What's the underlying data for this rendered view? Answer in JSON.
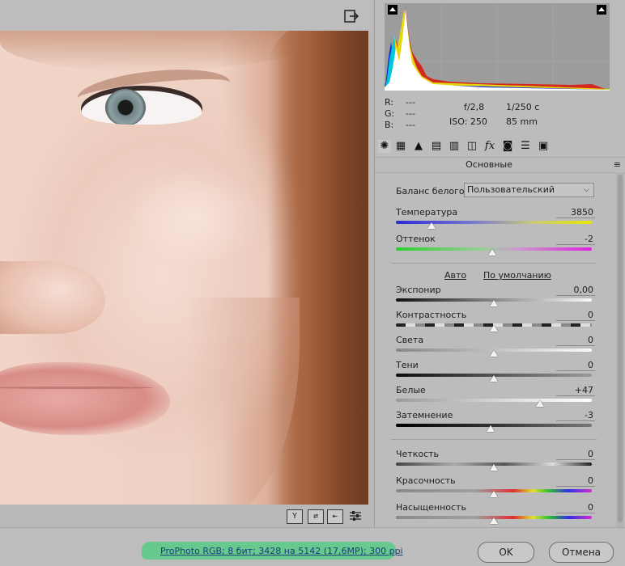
{
  "colors": {
    "status_highlight": "#63c98b",
    "link": "#1a3d7a",
    "slider_thumb": "#f4f4f4",
    "histogram_bg": "#9c9c9c"
  },
  "toolbar": {
    "export_icon": "export-icon"
  },
  "histogram": {
    "clip_shadow_icon": "shadow-clipping-icon",
    "clip_highlight_icon": "highlight-clipping-icon"
  },
  "readout": {
    "r_label": "R:",
    "r_value": "---",
    "g_label": "G:",
    "g_value": "---",
    "b_label": "B:",
    "b_value": "---",
    "aperture": "f/2,8",
    "shutter": "1/250 c",
    "iso": "ISO: 250",
    "focal": "85 mm"
  },
  "tabs": [
    {
      "icon": "aperture-icon",
      "active": true
    },
    {
      "icon": "tone-curve-icon"
    },
    {
      "icon": "detail-icon"
    },
    {
      "icon": "hsl-icon"
    },
    {
      "icon": "split-toning-icon"
    },
    {
      "icon": "lens-correction-icon"
    },
    {
      "icon": "effects-fx-icon"
    },
    {
      "icon": "camera-calibration-icon"
    },
    {
      "icon": "presets-icon"
    },
    {
      "icon": "snapshots-icon"
    }
  ],
  "panel": {
    "title": "Основные",
    "menu_icon": "panel-menu-icon",
    "white_balance_label": "Баланс белого:",
    "white_balance_value": "Пользовательский",
    "auto_link": "Авто",
    "default_link": "По умолчанию"
  },
  "sliders": {
    "temperature": {
      "label": "Температура",
      "value": "3850",
      "position": 0.18
    },
    "tint": {
      "label": "Оттенок",
      "value": "-2",
      "position": 0.49
    },
    "exposure": {
      "label": "Экспонир",
      "value": "0,00",
      "position": 0.5
    },
    "contrast": {
      "label": "Контрастность",
      "value": "0",
      "position": 0.5
    },
    "highlights": {
      "label": "Света",
      "value": "0",
      "position": 0.5
    },
    "shadows": {
      "label": "Тени",
      "value": "0",
      "position": 0.5
    },
    "whites": {
      "label": "Белые",
      "value": "+47",
      "position": 0.735
    },
    "blacks": {
      "label": "Затемнение",
      "value": "-3",
      "position": 0.485
    },
    "clarity": {
      "label": "Четкость",
      "value": "0",
      "position": 0.5
    },
    "vibrance": {
      "label": "Красочность",
      "value": "0",
      "position": 0.5
    },
    "saturation": {
      "label": "Насыщенность",
      "value": "0",
      "position": 0.5
    }
  },
  "viewer_bottom": {
    "btn_y": "Y",
    "btn_swap": "⇄",
    "btn_copy": "⇤",
    "btn_settings_icon": "settings-sliders-icon"
  },
  "status": {
    "workflow_link": "ProPhoto RGB; 8 бит; 3428 на 5142 (17,6MP); 300 ppi",
    "ok_label": "OK",
    "cancel_label": "Отмена"
  }
}
